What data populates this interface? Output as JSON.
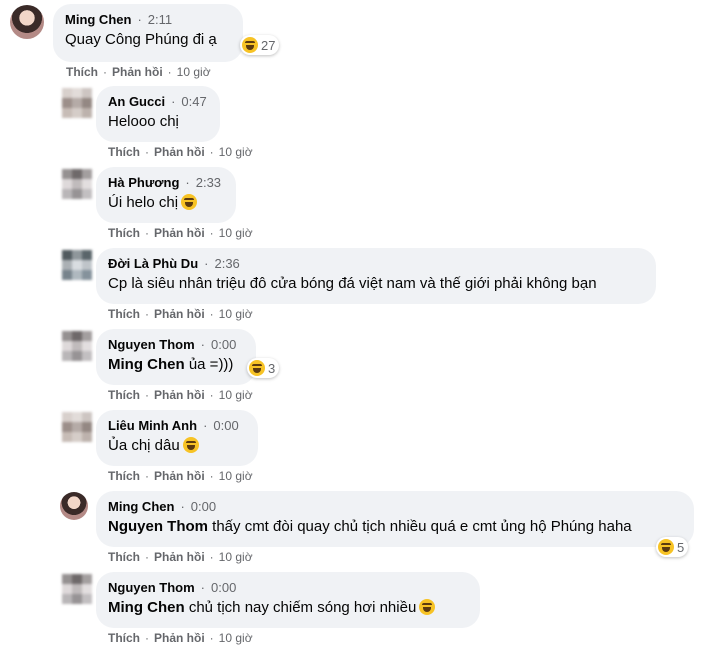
{
  "actions": {
    "like": "Thích",
    "reply": "Phản hồi",
    "ago": "10 giờ"
  },
  "comments": [
    {
      "name": "Ming Chen",
      "time": "2:11",
      "mention": "",
      "text": "Quay Công Phúng đi ạ",
      "reaction_count": "27"
    },
    {
      "name": "An Gucci",
      "time": "0:47",
      "mention": "",
      "text": "Helooo chị",
      "reaction_count": ""
    },
    {
      "name": "Hà Phương",
      "time": "2:33",
      "mention": "",
      "text": "Úi helo chị",
      "reaction_count": ""
    },
    {
      "name": "Đời Là Phù Du",
      "time": "2:36",
      "mention": "",
      "text": "Cp là siêu nhân triệu đô cửa bóng đá việt nam và thế giới phải không bạn",
      "reaction_count": ""
    },
    {
      "name": "Nguyen Thom",
      "time": "0:00",
      "mention": "Ming Chen",
      "text": "ủa =)))",
      "reaction_count": "3"
    },
    {
      "name": "Liêu Minh Anh",
      "time": "0:00",
      "mention": "",
      "text": "Ủa chị dâu",
      "reaction_count": ""
    },
    {
      "name": "Ming Chen",
      "time": "0:00",
      "mention": "Nguyen Thom",
      "text": "thấy cmt đòi quay chủ tịch nhiều quá e cmt ủng hộ Phúng haha",
      "reaction_count": "5"
    },
    {
      "name": "Nguyen Thom",
      "time": "0:00",
      "mention": "Ming Chen",
      "text": "chủ tịch nay chiếm sóng hơi nhiều",
      "reaction_count": ""
    }
  ],
  "icons": {
    "reaction": "laughing-emoji-icon",
    "inline": "rofl-emoji-icon"
  },
  "colors": {
    "bubble": "#f0f2f5",
    "meta": "#65676b",
    "emoji": "#f7c325"
  }
}
